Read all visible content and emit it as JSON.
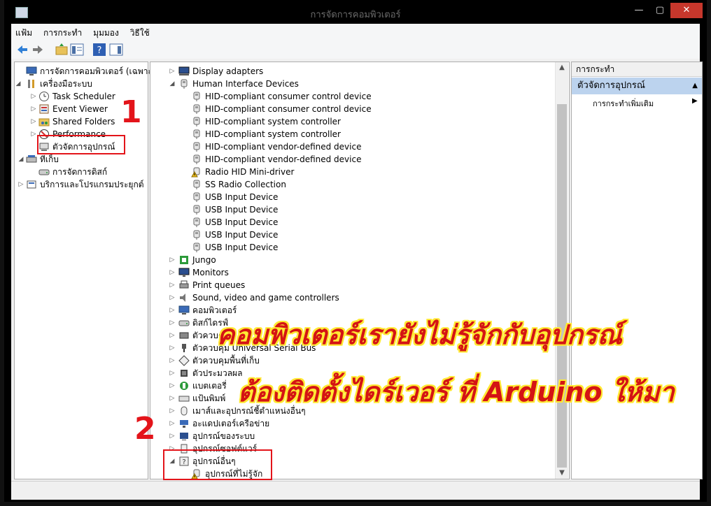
{
  "window": {
    "title": "การจัดการคอมพิวเตอร์",
    "min": "—",
    "max": "▢",
    "close": "✕"
  },
  "menu": [
    "แฟ้ม",
    "การกระทำ",
    "มุมมอง",
    "วิธีใช้"
  ],
  "left_tree": [
    {
      "label": "การจัดการคอมพิวเตอร์ (เฉพาะที่)",
      "arrow": "",
      "icon": "computer-icon"
    },
    {
      "label": "เครื่องมือระบบ",
      "arrow": "◢",
      "icon": "tools-icon"
    },
    {
      "label": "Task Scheduler",
      "arrow": "▷",
      "icon": "clock-icon"
    },
    {
      "label": "Event Viewer",
      "arrow": "▷",
      "icon": "event-viewer-icon"
    },
    {
      "label": "Shared Folders",
      "arrow": "▷",
      "icon": "shared-folder-icon"
    },
    {
      "label": "Performance",
      "arrow": "▷",
      "icon": "performance-icon"
    },
    {
      "label": "ตัวจัดการอุปกรณ์",
      "arrow": "",
      "icon": "device-manager-icon"
    },
    {
      "label": "ที่เก็บ",
      "arrow": "◢",
      "icon": "storage-icon"
    },
    {
      "label": "การจัดการดิสก์",
      "arrow": "",
      "icon": "disk-icon"
    },
    {
      "label": "บริการและโปรแกรมประยุกต์",
      "arrow": "▷",
      "icon": "services-icon"
    }
  ],
  "device_tree": [
    {
      "label": "Display adapters",
      "arrow": "▷",
      "icon": "display-adapter-icon",
      "level": 0
    },
    {
      "label": "Human Interface Devices",
      "arrow": "◢",
      "icon": "hid-icon",
      "level": 0
    },
    {
      "label": "HID-compliant consumer control device",
      "arrow": "",
      "icon": "hid-icon",
      "level": 1
    },
    {
      "label": "HID-compliant consumer control device",
      "arrow": "",
      "icon": "hid-icon",
      "level": 1
    },
    {
      "label": "HID-compliant system controller",
      "arrow": "",
      "icon": "hid-icon",
      "level": 1
    },
    {
      "label": "HID-compliant system controller",
      "arrow": "",
      "icon": "hid-icon",
      "level": 1
    },
    {
      "label": "HID-compliant vendor-defined device",
      "arrow": "",
      "icon": "hid-icon",
      "level": 1
    },
    {
      "label": "HID-compliant vendor-defined device",
      "arrow": "",
      "icon": "hid-icon",
      "level": 1
    },
    {
      "label": "Radio HID Mini-driver",
      "arrow": "",
      "icon": "warning-device-icon",
      "level": 1
    },
    {
      "label": "SS Radio Collection",
      "arrow": "",
      "icon": "hid-icon",
      "level": 1
    },
    {
      "label": "USB Input Device",
      "arrow": "",
      "icon": "hid-icon",
      "level": 1
    },
    {
      "label": "USB Input Device",
      "arrow": "",
      "icon": "hid-icon",
      "level": 1
    },
    {
      "label": "USB Input Device",
      "arrow": "",
      "icon": "hid-icon",
      "level": 1
    },
    {
      "label": "USB Input Device",
      "arrow": "",
      "icon": "hid-icon",
      "level": 1
    },
    {
      "label": "USB Input Device",
      "arrow": "",
      "icon": "hid-icon",
      "level": 1
    },
    {
      "label": "Jungo",
      "arrow": "▷",
      "icon": "jungo-icon",
      "level": 0
    },
    {
      "label": "Monitors",
      "arrow": "▷",
      "icon": "monitor-icon",
      "level": 0
    },
    {
      "label": "Print queues",
      "arrow": "▷",
      "icon": "printer-icon",
      "level": 0
    },
    {
      "label": "Sound, video and game controllers",
      "arrow": "▷",
      "icon": "sound-icon",
      "level": 0
    },
    {
      "label": "คอมพิวเตอร์",
      "arrow": "▷",
      "icon": "computer-icon",
      "level": 0
    },
    {
      "label": "ดิสก์ไดรฟ์",
      "arrow": "▷",
      "icon": "disk-icon",
      "level": 0
    },
    {
      "label": "ตัวควบคุม",
      "arrow": "▷",
      "icon": "controller-icon",
      "level": 0
    },
    {
      "label": "ตัวควบคุม Universal Serial Bus",
      "arrow": "▷",
      "icon": "usb-icon",
      "level": 0
    },
    {
      "label": "ตัวควบคุมพื้นที่เก็บ",
      "arrow": "▷",
      "icon": "storage-controller-icon",
      "level": 0
    },
    {
      "label": "ตัวประมวลผล",
      "arrow": "▷",
      "icon": "processor-icon",
      "level": 0
    },
    {
      "label": "แบตเตอรี่",
      "arrow": "▷",
      "icon": "battery-icon",
      "level": 0
    },
    {
      "label": "แป้นพิมพ์",
      "arrow": "▷",
      "icon": "keyboard-icon",
      "level": 0
    },
    {
      "label": "เมาส์และอุปกรณ์ชี้ตำแหน่งอื่นๆ",
      "arrow": "▷",
      "icon": "mouse-icon",
      "level": 0
    },
    {
      "label": "อะแดปเตอร์เครือข่าย",
      "arrow": "▷",
      "icon": "network-icon",
      "level": 0
    },
    {
      "label": "อุปกรณ์ของระบบ",
      "arrow": "▷",
      "icon": "system-device-icon",
      "level": 0
    },
    {
      "label": "อุปกรณ์ซอฟต์แวร์",
      "arrow": "▷",
      "icon": "software-device-icon",
      "level": 0
    },
    {
      "label": "อุปกรณ์อื่นๆ",
      "arrow": "◢",
      "icon": "other-device-icon",
      "level": 0
    },
    {
      "label": "อุปกรณ์ที่ไม่รู้จัก",
      "arrow": "",
      "icon": "warning-device-icon",
      "level": 1
    }
  ],
  "actions": {
    "header": "การกระทำ",
    "group": "ตัวจัดการอุปกรณ์",
    "more": "การกระทำเพิ่มเติม",
    "collapse_arrow": "▲",
    "more_arrow": "▶"
  },
  "annotations": {
    "num1": "1",
    "num2": "2",
    "line1": "คอมพิวเตอร์เรายังไม่รู้จักกับอุปกรณ์",
    "line2": "ต้องติดตั้งไดร์เวอร์ ที่ Arduino ให้มา",
    "color_red": "#e3141a",
    "color_yellow": "#ffe933"
  }
}
